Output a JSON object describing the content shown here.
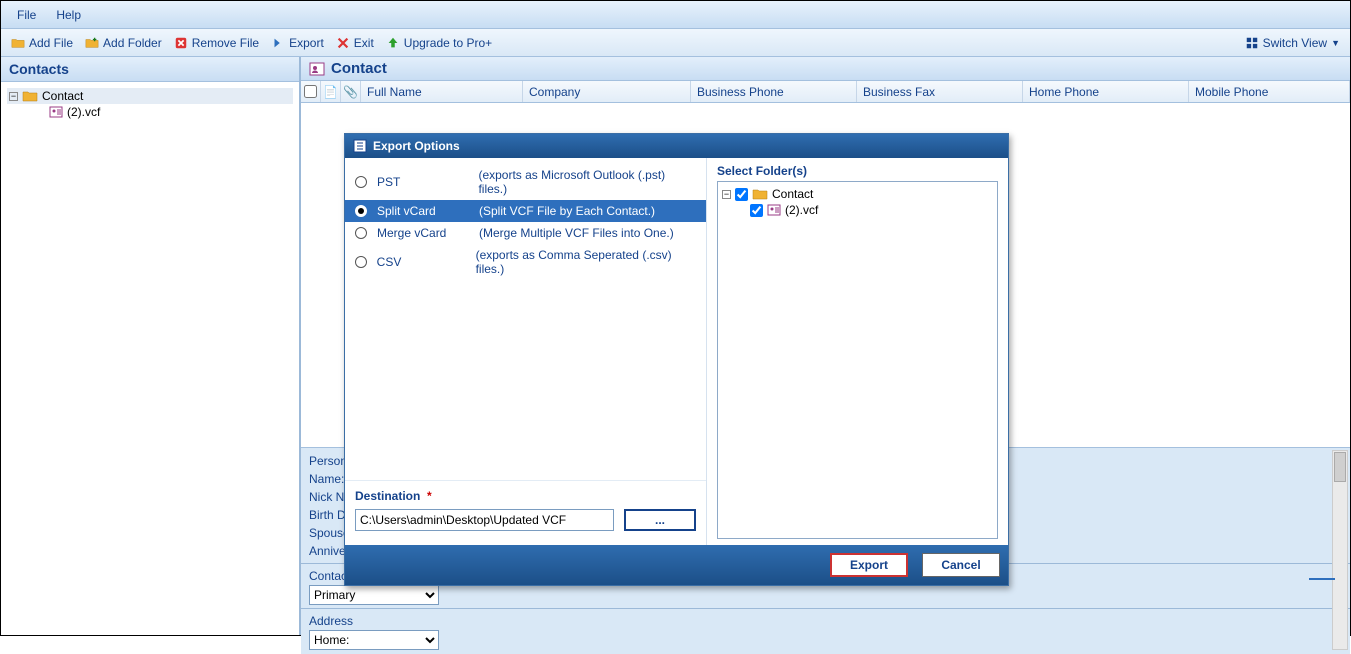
{
  "menu": {
    "file": "File",
    "help": "Help"
  },
  "toolbar": {
    "add_file": "Add File",
    "add_folder": "Add Folder",
    "remove_file": "Remove File",
    "export": "Export",
    "exit": "Exit",
    "upgrade": "Upgrade to Pro+",
    "switch_view": "Switch View"
  },
  "sidebar": {
    "title": "Contacts",
    "root": "Contact",
    "file": "(2).vcf"
  },
  "mainpanel": {
    "title": "Contact",
    "columns": [
      "Full Name",
      "Company",
      "Business Phone",
      "Business Fax",
      "Home Phone",
      "Mobile Phone"
    ]
  },
  "details": {
    "personal": "Persona",
    "name": "Name:",
    "nick": "Nick Na",
    "birth": "Birth Da",
    "spouse": "Spouse",
    "anniv": "Anniver",
    "contact_section": "Contact",
    "primary": "Primary",
    "address_section": "Address",
    "home": "Home:"
  },
  "dialog": {
    "title": "Export Options",
    "options": [
      {
        "name": "PST",
        "desc": "(exports as Microsoft Outlook (.pst) files.)",
        "selected": false
      },
      {
        "name": "Split vCard",
        "desc": "(Split VCF File by Each Contact.)",
        "selected": true
      },
      {
        "name": "Merge vCard",
        "desc": "(Merge Multiple VCF Files into One.)",
        "selected": false
      },
      {
        "name": "CSV",
        "desc": "(exports as Comma Seperated (.csv) files.)",
        "selected": false
      }
    ],
    "dest_label": "Destination",
    "dest_value": "C:\\Users\\admin\\Desktop\\Updated VCF",
    "browse": "...",
    "folders_label": "Select Folder(s)",
    "folder_root": "Contact",
    "folder_file": "(2).vcf",
    "export_btn": "Export",
    "cancel_btn": "Cancel"
  }
}
